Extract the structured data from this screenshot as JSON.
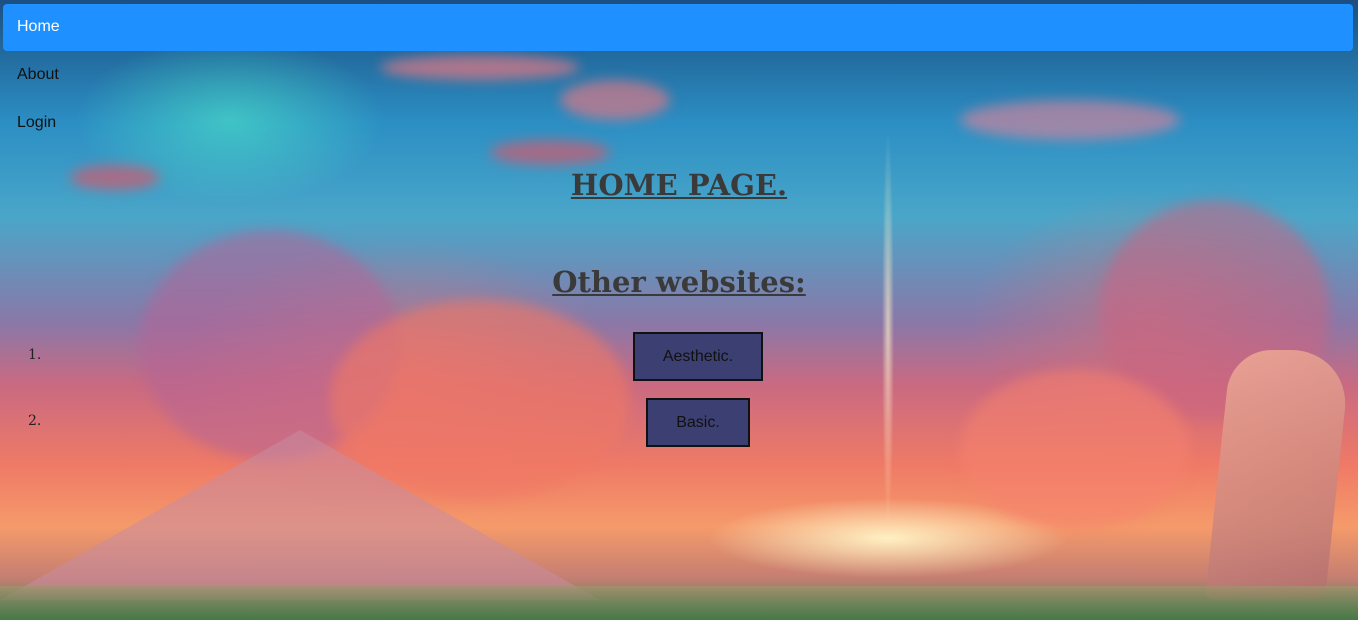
{
  "nav": {
    "items": [
      {
        "label": "Home",
        "active": true
      },
      {
        "label": "About",
        "active": false
      },
      {
        "label": "Login",
        "active": false
      }
    ]
  },
  "main": {
    "title": "HOME PAGE.",
    "subtitle": "Other websites:",
    "list": [
      {
        "number": "1.",
        "button_label": "Aesthetic."
      },
      {
        "number": "2.",
        "button_label": "Basic."
      }
    ]
  },
  "colors": {
    "nav_active_bg": "#1e90ff",
    "button_bg": "#3c3f72",
    "heading_text": "#3a3a3a"
  }
}
